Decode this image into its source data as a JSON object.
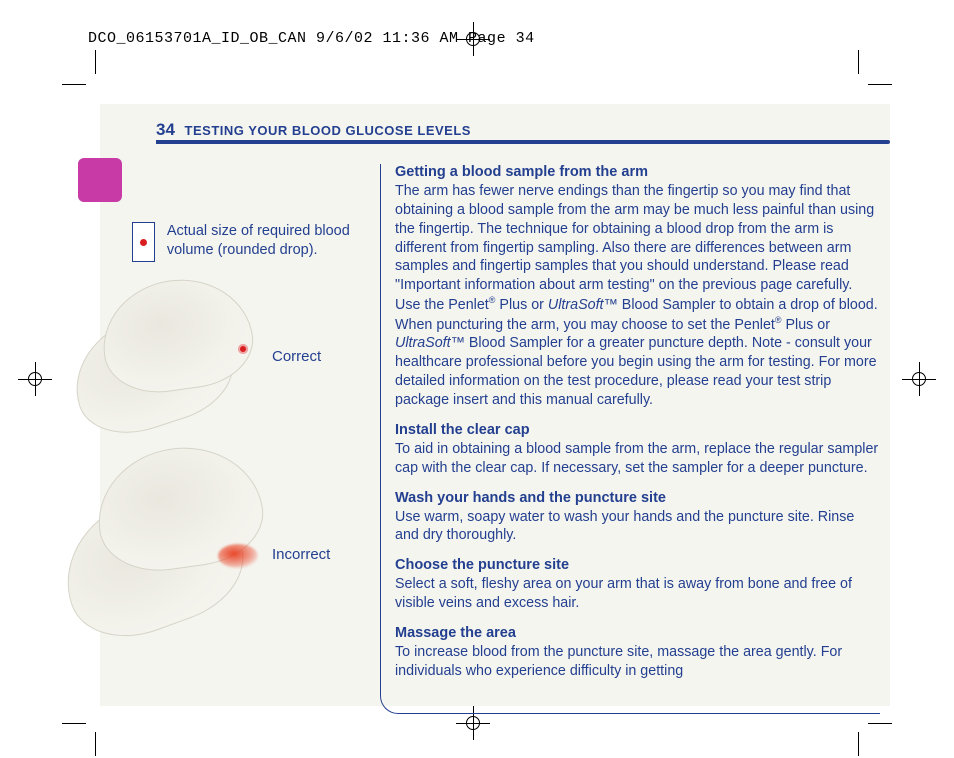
{
  "slug": "DCO_06153701A_ID_OB_CAN  9/6/02  11:36 AM  Page 34",
  "page_number": "34",
  "running_title": "TESTING YOUR BLOOD GLUCOSE LEVELS",
  "left": {
    "drop_caption": "Actual size of required blood volume (rounded drop).",
    "correct_label": "Correct",
    "incorrect_label": "Incorrect"
  },
  "sections": [
    {
      "heading": "Getting a blood sample from the arm",
      "body_html": "The arm has fewer nerve endings than the fingertip so you may find that obtaining a blood sample from the arm may be much less painful than using the fingertip. The technique for obtaining a blood drop from the arm is different from fingertip sampling. Also there are differences between arm samples and fingertip samples that you should understand. Please read \"Important information about arm testing\" on the previous page carefully. Use the Penlet<span class='sup'>®</span> Plus or <em>UltraSoft</em>™ Blood Sampler to obtain a drop of blood. When puncturing the arm, you may choose to set the Penlet<span class='sup'>®</span> Plus or <em>UltraSoft</em>™ Blood Sampler for a greater puncture depth. Note - consult your healthcare professional before you begin using the arm for testing. For more detailed information on the test procedure, please read your test strip package insert and this manual carefully."
    },
    {
      "heading": "Install the clear cap",
      "body_html": "To aid in obtaining a blood sample from the arm, replace the regular sampler cap with the clear cap. If necessary, set the sampler for a deeper puncture."
    },
    {
      "heading": "Wash your hands and the puncture site",
      "body_html": "Use warm, soapy water to wash your hands and the puncture site. Rinse and dry thoroughly."
    },
    {
      "heading": "Choose the puncture site",
      "body_html": "Select a soft, fleshy area on your arm that is away from bone and free of visible veins and excess hair."
    },
    {
      "heading": "Massage the area",
      "body_html": "To increase blood from the puncture site, massage the area gently. For individuals who experience difficulty in getting"
    }
  ]
}
